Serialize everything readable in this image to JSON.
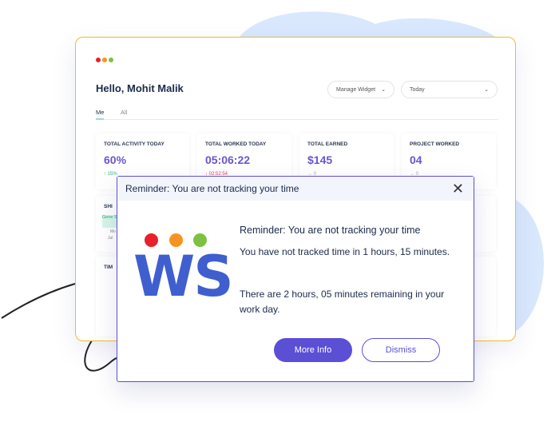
{
  "colors": {
    "accent": "#5b4fd6",
    "border": "#f5b82e",
    "logo_blue": "#3f5fcf",
    "dot_red": "#e8202a",
    "dot_orange": "#f7931e",
    "dot_green": "#7cc142"
  },
  "dashboard": {
    "greeting": "Hello, Mohit Malik",
    "manage_widget": "Manage Widget",
    "date_select": "Today",
    "tabs": [
      {
        "label": "Me",
        "active": true
      },
      {
        "label": "All",
        "active": false
      }
    ],
    "stats": [
      {
        "label": "TOTAL ACTIVITY TODAY",
        "value": "60%",
        "delta": "↑ 15%"
      },
      {
        "label": "TOTAL WORKED TODAY",
        "value": "05:06:22",
        "delta": "↓ 02:52:54"
      },
      {
        "label": "TOTAL EARNED",
        "value": "$145",
        "delta": "→ 0"
      },
      {
        "label": "PROJECT WORKED",
        "value": "04",
        "delta": "→ 0"
      }
    ],
    "shift_label": "SHI",
    "shift_badge": "Gene Shi",
    "shift_sub1": "Mo",
    "shift_sub2": "Jul",
    "time_label": "TIM"
  },
  "modal": {
    "header": "Reminder: You are not tracking your time",
    "title": "Reminder: You are not tracking your time",
    "line1": "You have not tracked time in 1 hours, 15 minutes.",
    "line2": "There are 2 hours, 05 minutes remaining in your work day.",
    "logo_text": "WS",
    "more_info": "More Info",
    "dismiss": "Dismiss",
    "close_icon": "close-icon"
  }
}
